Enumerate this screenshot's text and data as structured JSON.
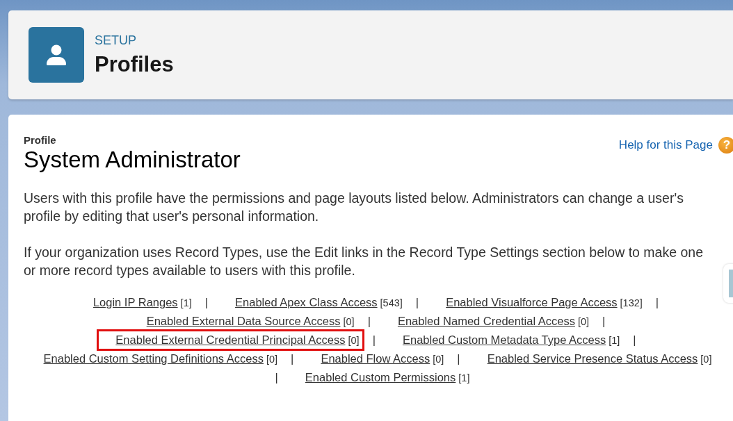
{
  "header": {
    "eyebrow": "SETUP",
    "title": "Profiles"
  },
  "profile": {
    "label": "Profile",
    "name": "System Administrator",
    "help_link": "Help for this Page",
    "help_icon": "?"
  },
  "paragraphs": [
    "Users with this profile have the permissions and page layouts listed below. Administrators can change a user's profile by editing that user's personal information.",
    "If your organization uses Record Types, use the Edit links in the Record Type Settings section below to make one or more record types available to users with this profile."
  ],
  "link_rows": [
    [
      {
        "kind": "link",
        "label": "Login IP Ranges",
        "count": "[1]",
        "highlighted": false
      },
      {
        "kind": "separator",
        "label": "|"
      },
      {
        "kind": "link",
        "label": "Enabled Apex Class Access",
        "count": "[543]",
        "highlighted": false
      },
      {
        "kind": "separator",
        "label": "|"
      },
      {
        "kind": "link",
        "label": "Enabled Visualforce Page Access",
        "count": "[132]",
        "highlighted": false
      },
      {
        "kind": "separator",
        "label": "|"
      }
    ],
    [
      {
        "kind": "link",
        "label": "Enabled External Data Source Access",
        "count": "[0]",
        "highlighted": false
      },
      {
        "kind": "separator",
        "label": "|"
      },
      {
        "kind": "link",
        "label": "Enabled Named Credential Access",
        "count": "[0]",
        "highlighted": false
      },
      {
        "kind": "separator",
        "label": "|"
      }
    ],
    [
      {
        "kind": "link",
        "label": "Enabled External Credential Principal Access",
        "count": "[0]",
        "highlighted": true
      },
      {
        "kind": "separator",
        "label": "|"
      },
      {
        "kind": "link",
        "label": "Enabled Custom Metadata Type Access",
        "count": "[1]",
        "highlighted": false
      },
      {
        "kind": "separator",
        "label": "|"
      }
    ],
    [
      {
        "kind": "link",
        "label": "Enabled Custom Setting Definitions Access",
        "count": "[0]",
        "highlighted": false
      },
      {
        "kind": "separator",
        "label": "|"
      },
      {
        "kind": "link",
        "label": "Enabled Flow Access",
        "count": "[0]",
        "highlighted": false
      },
      {
        "kind": "separator",
        "label": "|"
      },
      {
        "kind": "link",
        "label": "Enabled Service Presence Status Access",
        "count": "[0]",
        "highlighted": false
      }
    ],
    [
      {
        "kind": "separator",
        "label": "|"
      },
      {
        "kind": "link",
        "label": "Enabled Custom Permissions",
        "count": "[1]",
        "highlighted": false
      }
    ]
  ]
}
